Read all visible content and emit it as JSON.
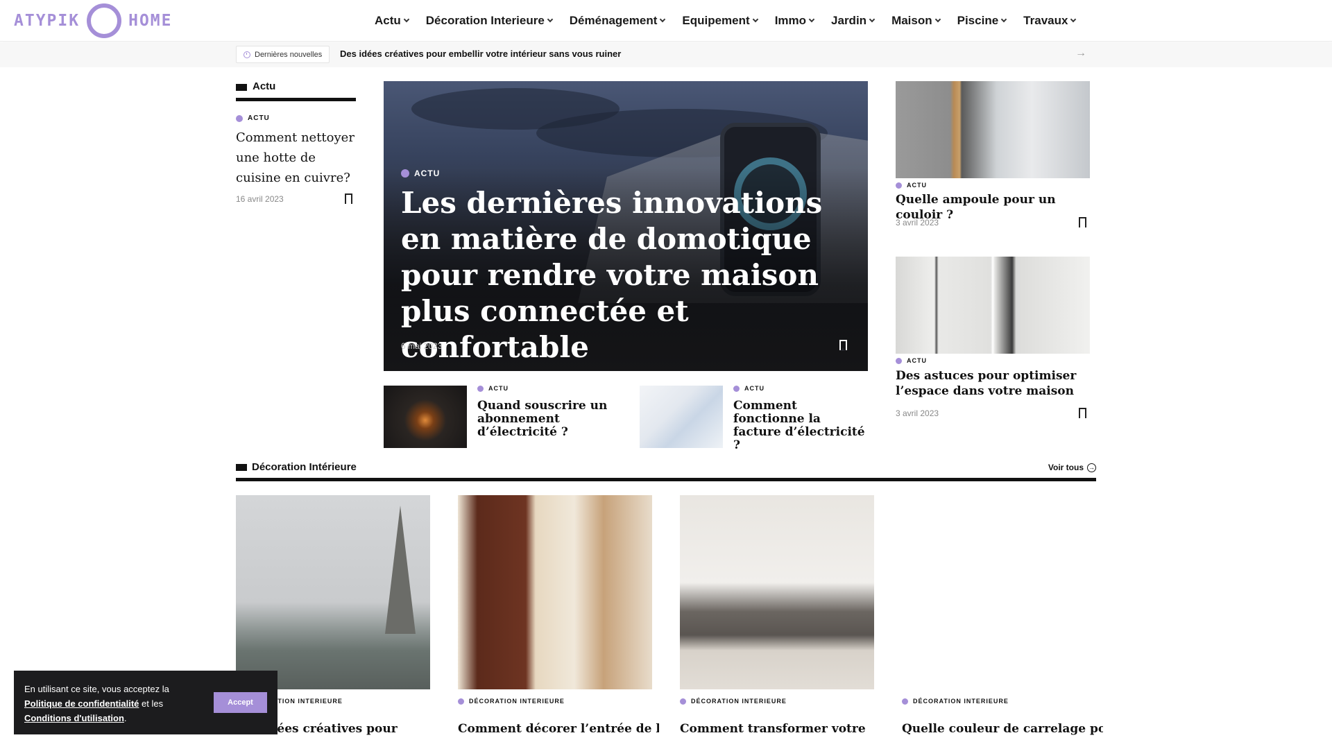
{
  "header": {
    "logo_left": "ATYPIK",
    "logo_right": "HOME",
    "nav": [
      "Actu",
      "Décoration Interieure",
      "Déménagement",
      "Equipement",
      "Immo",
      "Jardin",
      "Maison",
      "Piscine",
      "Travaux"
    ]
  },
  "ticker": {
    "badge": "Dernières nouvelles",
    "headline": "Des idées créatives pour embellir votre intérieur sans vous ruiner"
  },
  "sidebar": {
    "heading": "Actu",
    "category": "ACTU",
    "title": "Comment nettoyer une hotte de cuisine en cuivre?",
    "date": "16 avril 2023"
  },
  "featured": {
    "category": "ACTU",
    "title": "Les dernières innovations en matière de domotique pour rendre votre maison plus connectée et confortable",
    "date": "6 mai 2023"
  },
  "small_posts": [
    {
      "category": "ACTU",
      "title": "Quand souscrire un abonnement d’électricité ?"
    },
    {
      "category": "ACTU",
      "title": "Comment fonctionne la facture d’électricité ?"
    }
  ],
  "right_posts": [
    {
      "category": "ACTU",
      "title": "Quelle ampoule pour un couloir ?",
      "date": "3 avril 2023"
    },
    {
      "category": "ACTU",
      "title": "Des astuces pour optimiser l’espace dans votre maison",
      "date": "3 avril 2023"
    }
  ],
  "section2": {
    "heading": "Décoration Intérieure",
    "view_all": "Voir tous",
    "cards": [
      {
        "category": "DÉCORATION INTERIEURE",
        "title": "Des idées créatives pour"
      },
      {
        "category": "DÉCORATION INTERIEURE",
        "title": "Comment décorer l’entrée de la"
      },
      {
        "category": "DÉCORATION INTERIEURE",
        "title": "Comment transformer votre"
      },
      {
        "category": "DÉCORATION INTERIEURE",
        "title": "Quelle couleur de carrelage pour"
      }
    ]
  },
  "cookie": {
    "text1": "En utilisant ce site, vous acceptez la",
    "link1": "Politique de confidentialité",
    "text2": "et les",
    "link2": "Conditions d'utilisation",
    "text3": ".",
    "button": "Accept"
  },
  "colors": {
    "accent": "#a58fd8",
    "dark": "#111111",
    "cookie_bg": "#1c1c1e"
  }
}
